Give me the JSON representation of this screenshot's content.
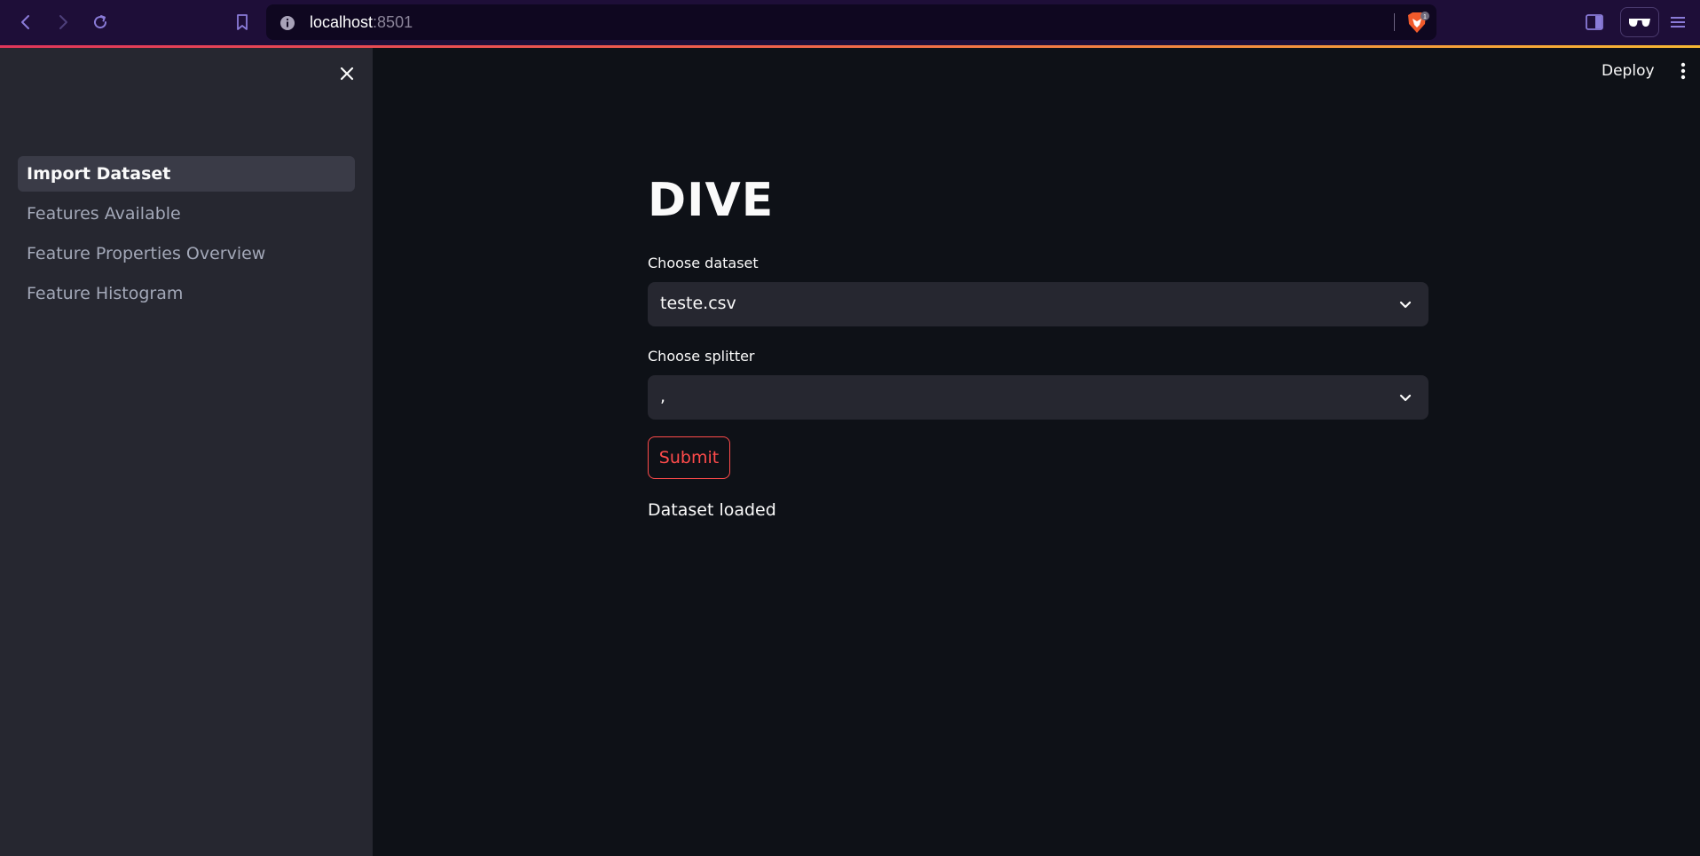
{
  "browser": {
    "url_host": "localhost",
    "url_port": ":8501",
    "icons": [
      "back-icon",
      "forward-icon",
      "reload-icon",
      "bookmark-icon",
      "info-icon",
      "brave-shield-icon",
      "sidebar-toggle-icon",
      "reader-mode-icon",
      "menu-icon"
    ]
  },
  "sidebar": {
    "items": [
      {
        "label": "Import Dataset",
        "active": true
      },
      {
        "label": "Features Available",
        "active": false
      },
      {
        "label": "Feature Properties Overview",
        "active": false
      },
      {
        "label": "Feature Histogram",
        "active": false
      }
    ]
  },
  "header": {
    "deploy_label": "Deploy"
  },
  "main": {
    "title": "DIVE",
    "dataset_label": "Choose dataset",
    "dataset_value": "teste.csv",
    "splitter_label": "Choose splitter",
    "splitter_value": ",",
    "submit_label": "Submit",
    "status_text": "Dataset loaded"
  },
  "colors": {
    "accent": "#ff4b4b",
    "background": "#0e1117",
    "sidebar": "#262730",
    "browser_chrome": "#1e0e38"
  }
}
